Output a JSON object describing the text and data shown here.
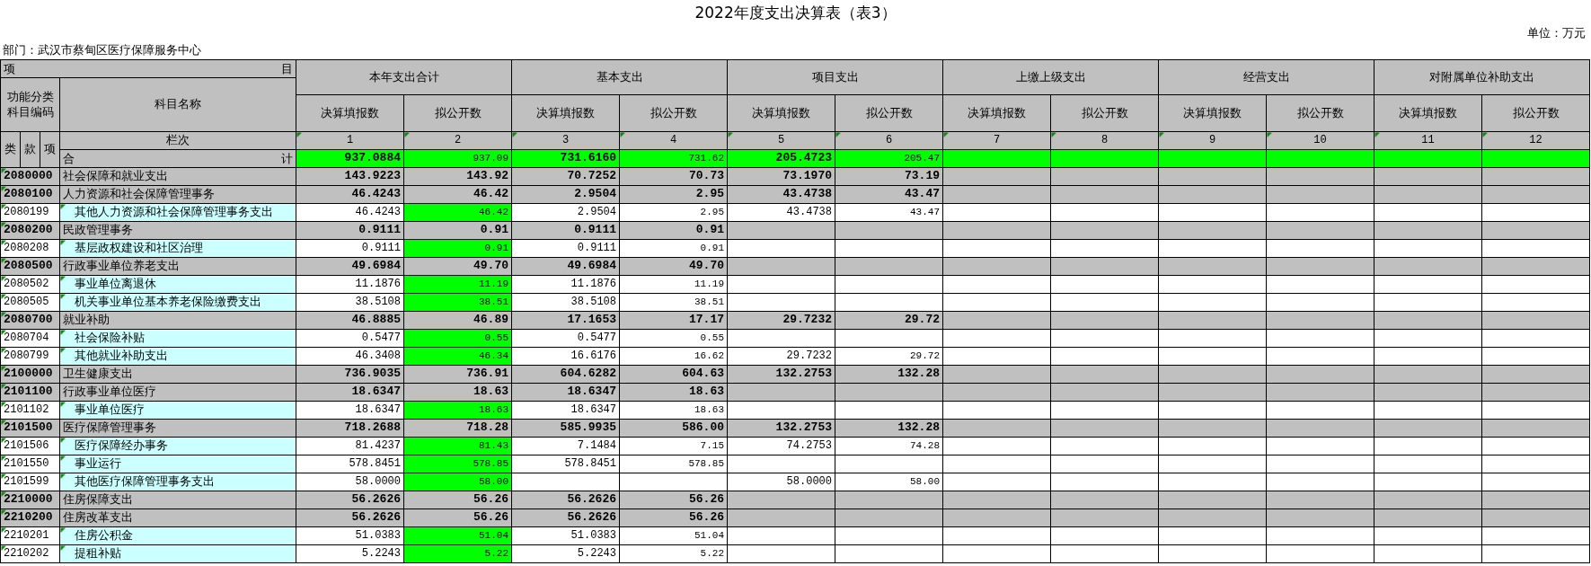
{
  "title": "2022年度支出决算表（表3）",
  "unit": "单位：万元",
  "department": "部门：武汉市蔡甸区医疗保障服务中心",
  "header": {
    "item_start": "项",
    "item_end": "目",
    "code_label": "功能分类科目编码",
    "name_label": "科目名称",
    "index_label": "栏次",
    "levels": [
      "类",
      "款",
      "项"
    ],
    "groups": [
      {
        "title": "本年支出合计",
        "columns": [
          "决算填报数",
          "拟公开数"
        ]
      },
      {
        "title": "基本支出",
        "columns": [
          "决算填报数",
          "拟公开数"
        ]
      },
      {
        "title": "项目支出",
        "columns": [
          "决算填报数",
          "拟公开数"
        ]
      },
      {
        "title": "上缴上级支出",
        "columns": [
          "决算填报数",
          "拟公开数"
        ]
      },
      {
        "title": "经营支出",
        "columns": [
          "决算填报数",
          "拟公开数"
        ]
      },
      {
        "title": "对附属单位补助支出",
        "columns": [
          "决算填报数",
          "拟公开数"
        ]
      }
    ],
    "column_numbers": [
      "1",
      "2",
      "3",
      "4",
      "5",
      "6",
      "7",
      "8",
      "9",
      "10",
      "11",
      "12"
    ]
  },
  "total": {
    "label_start": "合",
    "label_end": "计",
    "values": [
      "937.0884",
      "937.09",
      "731.6160",
      "731.62",
      "205.4723",
      "205.47"
    ]
  },
  "rows": [
    {
      "kind": "group",
      "code": "2080000",
      "name": "社会保障和就业支出",
      "values": [
        "143.9223",
        "143.92",
        "70.7252",
        "70.73",
        "73.1970",
        "73.19"
      ]
    },
    {
      "kind": "group",
      "code": "2080100",
      "name": "人力资源和社会保障管理事务",
      "values": [
        "46.4243",
        "46.42",
        "2.9504",
        "2.95",
        "43.4738",
        "43.47"
      ]
    },
    {
      "kind": "leaf",
      "code": "2080199",
      "name": "其他人力资源和社会保障管理事务支出",
      "values": [
        "46.4243",
        "46.42",
        "2.9504",
        "2.95",
        "43.4738",
        "43.47"
      ]
    },
    {
      "kind": "group",
      "code": "2080200",
      "name": "民政管理事务",
      "values": [
        "0.9111",
        "0.91",
        "0.9111",
        "0.91"
      ]
    },
    {
      "kind": "leaf",
      "code": "2080208",
      "name": "基层政权建设和社区治理",
      "values": [
        "0.9111",
        "0.91",
        "0.9111",
        "0.91"
      ]
    },
    {
      "kind": "group",
      "code": "2080500",
      "name": "行政事业单位养老支出",
      "values": [
        "49.6984",
        "49.70",
        "49.6984",
        "49.70"
      ]
    },
    {
      "kind": "leaf",
      "code": "2080502",
      "name": "事业单位离退休",
      "values": [
        "11.1876",
        "11.19",
        "11.1876",
        "11.19"
      ]
    },
    {
      "kind": "leaf",
      "code": "2080505",
      "name": "机关事业单位基本养老保险缴费支出",
      "values": [
        "38.5108",
        "38.51",
        "38.5108",
        "38.51"
      ]
    },
    {
      "kind": "group",
      "code": "2080700",
      "name": "就业补助",
      "values": [
        "46.8885",
        "46.89",
        "17.1653",
        "17.17",
        "29.7232",
        "29.72"
      ]
    },
    {
      "kind": "leaf",
      "code": "2080704",
      "name": "社会保险补贴",
      "values": [
        "0.5477",
        "0.55",
        "0.5477",
        "0.55"
      ]
    },
    {
      "kind": "leaf",
      "code": "2080799",
      "name": "其他就业补助支出",
      "values": [
        "46.3408",
        "46.34",
        "16.6176",
        "16.62",
        "29.7232",
        "29.72"
      ]
    },
    {
      "kind": "group",
      "code": "2100000",
      "name": "卫生健康支出",
      "values": [
        "736.9035",
        "736.91",
        "604.6282",
        "604.63",
        "132.2753",
        "132.28"
      ]
    },
    {
      "kind": "group",
      "code": "2101100",
      "name": "行政事业单位医疗",
      "values": [
        "18.6347",
        "18.63",
        "18.6347",
        "18.63"
      ]
    },
    {
      "kind": "leaf",
      "code": "2101102",
      "name": "事业单位医疗",
      "values": [
        "18.6347",
        "18.63",
        "18.6347",
        "18.63"
      ]
    },
    {
      "kind": "group",
      "code": "2101500",
      "name": "医疗保障管理事务",
      "values": [
        "718.2688",
        "718.28",
        "585.9935",
        "586.00",
        "132.2753",
        "132.28"
      ]
    },
    {
      "kind": "leaf",
      "code": "2101506",
      "name": "医疗保障经办事务",
      "values": [
        "81.4237",
        "81.43",
        "7.1484",
        "7.15",
        "74.2753",
        "74.28"
      ]
    },
    {
      "kind": "leaf",
      "code": "2101550",
      "name": "事业运行",
      "values": [
        "578.8451",
        "578.85",
        "578.8451",
        "578.85"
      ]
    },
    {
      "kind": "leaf",
      "code": "2101599",
      "name": "其他医疗保障管理事务支出",
      "values": {
        "c1": "58.0000",
        "c2": "58.00",
        "c5": "58.0000",
        "c6": "58.00"
      }
    },
    {
      "kind": "group",
      "code": "2210000",
      "name": "住房保障支出",
      "values": [
        "56.2626",
        "56.26",
        "56.2626",
        "56.26"
      ]
    },
    {
      "kind": "group",
      "code": "2210200",
      "name": "住房改革支出",
      "values": [
        "56.2626",
        "56.26",
        "56.2626",
        "56.26"
      ]
    },
    {
      "kind": "leaf",
      "code": "2210201",
      "name": "住房公积金",
      "values": [
        "51.0383",
        "51.04",
        "51.0383",
        "51.04"
      ]
    },
    {
      "kind": "leaf",
      "code": "2210202",
      "name": "提租补贴",
      "values": [
        "5.2243",
        "5.22",
        "5.2243",
        "5.22"
      ]
    }
  ]
}
